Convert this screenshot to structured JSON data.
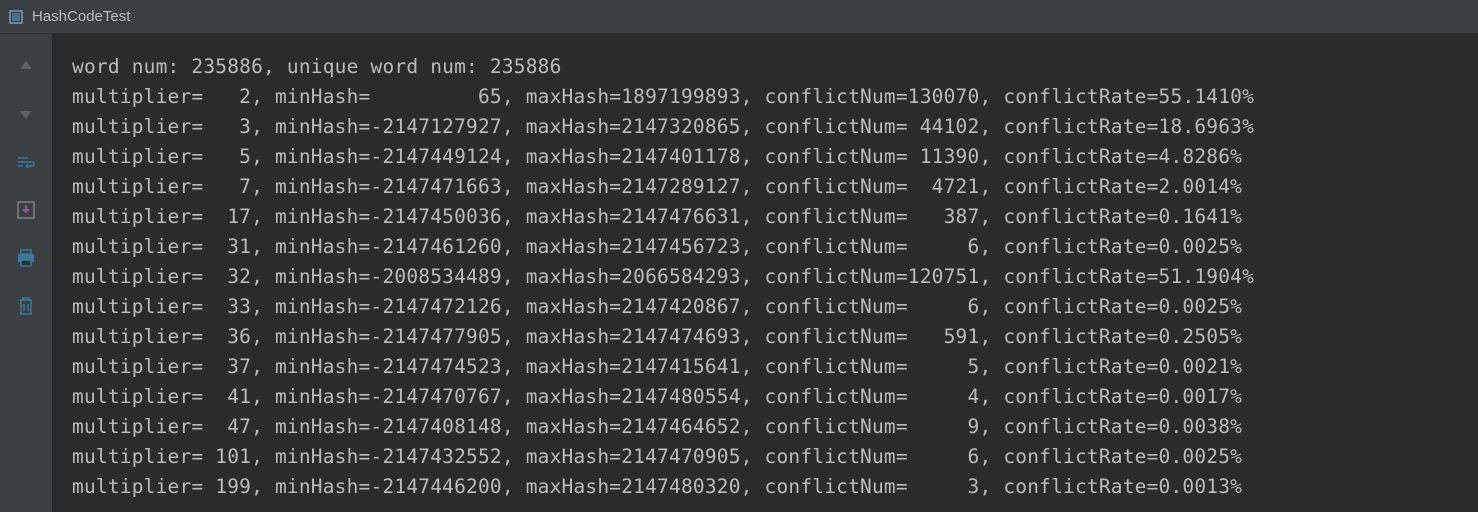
{
  "title": "HashCodeTest",
  "summary": {
    "word_num_label": "word num:",
    "word_num": "235886",
    "unique_word_num_label": "unique word num:",
    "unique_word_num": "235886"
  },
  "columns": {
    "multiplier": "multiplier=",
    "minHash": "minHash=",
    "maxHash": "maxHash=",
    "conflictNum": "conflictNum=",
    "conflictRate": "conflictRate="
  },
  "rows": [
    {
      "multiplier": "   2",
      "minHash": "         65",
      "maxHash": "1897199893",
      "conflictNum": "130070",
      "conflictRate": "55.1410%"
    },
    {
      "multiplier": "   3",
      "minHash": "-2147127927",
      "maxHash": "2147320865",
      "conflictNum": " 44102",
      "conflictRate": "18.6963%"
    },
    {
      "multiplier": "   5",
      "minHash": "-2147449124",
      "maxHash": "2147401178",
      "conflictNum": " 11390",
      "conflictRate": "4.8286%"
    },
    {
      "multiplier": "   7",
      "minHash": "-2147471663",
      "maxHash": "2147289127",
      "conflictNum": "  4721",
      "conflictRate": "2.0014%"
    },
    {
      "multiplier": "  17",
      "minHash": "-2147450036",
      "maxHash": "2147476631",
      "conflictNum": "   387",
      "conflictRate": "0.1641%"
    },
    {
      "multiplier": "  31",
      "minHash": "-2147461260",
      "maxHash": "2147456723",
      "conflictNum": "     6",
      "conflictRate": "0.0025%"
    },
    {
      "multiplier": "  32",
      "minHash": "-2008534489",
      "maxHash": "2066584293",
      "conflictNum": "120751",
      "conflictRate": "51.1904%"
    },
    {
      "multiplier": "  33",
      "minHash": "-2147472126",
      "maxHash": "2147420867",
      "conflictNum": "     6",
      "conflictRate": "0.0025%"
    },
    {
      "multiplier": "  36",
      "minHash": "-2147477905",
      "maxHash": "2147474693",
      "conflictNum": "   591",
      "conflictRate": "0.2505%"
    },
    {
      "multiplier": "  37",
      "minHash": "-2147474523",
      "maxHash": "2147415641",
      "conflictNum": "     5",
      "conflictRate": "0.0021%"
    },
    {
      "multiplier": "  41",
      "minHash": "-2147470767",
      "maxHash": "2147480554",
      "conflictNum": "     4",
      "conflictRate": "0.0017%"
    },
    {
      "multiplier": "  47",
      "minHash": "-2147408148",
      "maxHash": "2147464652",
      "conflictNum": "     9",
      "conflictRate": "0.0038%"
    },
    {
      "multiplier": " 101",
      "minHash": "-2147432552",
      "maxHash": "2147470905",
      "conflictNum": "     6",
      "conflictRate": "0.0025%"
    },
    {
      "multiplier": " 199",
      "minHash": "-2147446200",
      "maxHash": "2147480320",
      "conflictNum": "     3",
      "conflictRate": "0.0013%"
    }
  ],
  "toolbar": {
    "up": "up-arrow",
    "down": "down-arrow",
    "wrap": "soft-wrap",
    "scroll": "scroll-to-end",
    "print": "print",
    "clear": "clear-all"
  }
}
